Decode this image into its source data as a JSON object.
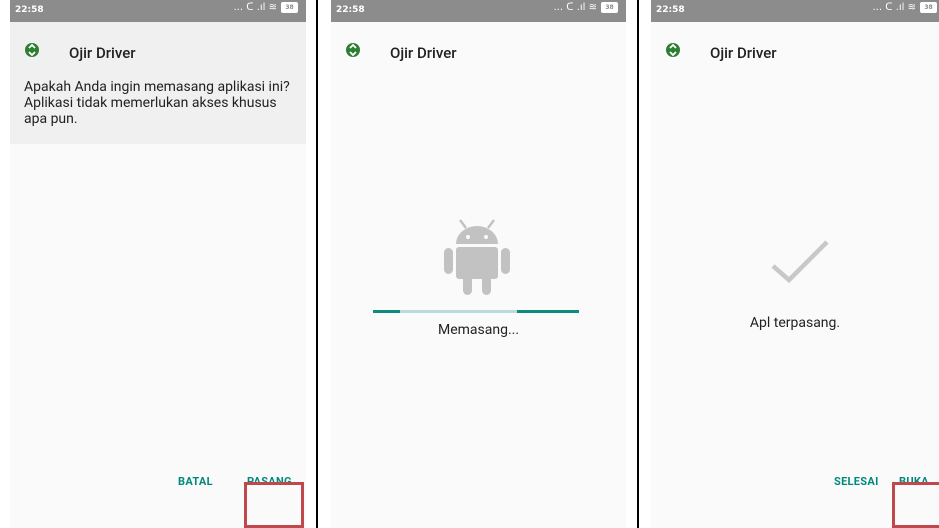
{
  "status_bar": {
    "time": "22:58",
    "signal_glyph": "... ᑕ .ıl ≋",
    "battery": "38"
  },
  "screen1": {
    "app_name": "Ojir Driver",
    "message": "Apakah Anda ingin memasang aplikasi ini? Aplikasi tidak memerlukan akses khusus apa pun.",
    "cancel_label": "BATAL",
    "install_label": "PASANG"
  },
  "screen2": {
    "app_name": "Ojir Driver",
    "status_text": "Memasang...",
    "progress_segments": [
      [
        0,
        0.13
      ],
      [
        0.7,
        1.0
      ]
    ]
  },
  "screen3": {
    "app_name": "Ojir Driver",
    "status_text": "Apl terpasang.",
    "done_label": "SELESAI",
    "open_label": "BUKA"
  },
  "colors": {
    "accent": "#00897b",
    "highlight": "#c0484d",
    "statusbar": "#8c8c8c",
    "icon_green": "#2e7d32"
  }
}
